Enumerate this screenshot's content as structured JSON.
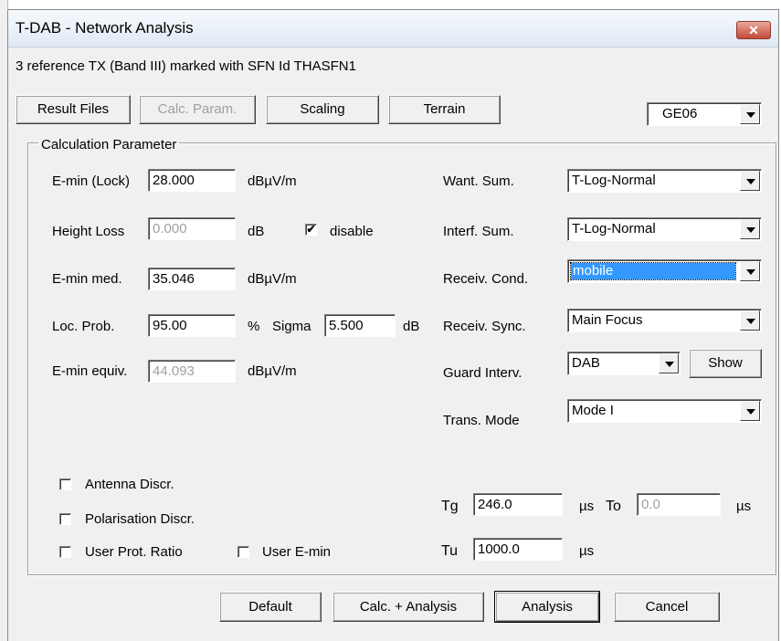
{
  "window": {
    "title": "T-DAB - Network Analysis",
    "close_glyph": "✕",
    "info_line": "3 reference TX (Band III) marked with SFN Id THASFN1"
  },
  "toolbar": {
    "result_files": "Result Files",
    "calc_param": "Calc. Param.",
    "scaling": "Scaling",
    "terrain": "Terrain",
    "plan": "GE06"
  },
  "group": {
    "title": "Calculation Parameter"
  },
  "left": {
    "emin_lock": {
      "label": "E-min (Lock)",
      "value": "28.000",
      "unit": "dBµV/m"
    },
    "height_loss": {
      "label": "Height Loss",
      "value": "0.000",
      "unit": "dB",
      "disable_label": "disable",
      "disable_checked": "✔"
    },
    "emin_med": {
      "label": "E-min med.",
      "value": "35.046",
      "unit": "dBµV/m"
    },
    "loc_prob": {
      "label": "Loc. Prob.",
      "value": "95.00",
      "unit": "%",
      "sigma_label": "Sigma",
      "sigma_value": "5.500",
      "sigma_unit": "dB"
    },
    "emin_equiv": {
      "label": "E-min equiv.",
      "value": "44.093",
      "unit": "dBµV/m"
    }
  },
  "right": {
    "want_sum": {
      "label": "Want. Sum.",
      "value": "T-Log-Normal"
    },
    "interf_sum": {
      "label": "Interf. Sum.",
      "value": "T-Log-Normal"
    },
    "receiv_cond": {
      "label": "Receiv. Cond.",
      "value": "mobile"
    },
    "receiv_sync": {
      "label": "Receiv. Sync.",
      "value": "Main Focus"
    },
    "guard_interv": {
      "label": "Guard Interv.",
      "value": "DAB",
      "show_button": "Show"
    },
    "trans_mode": {
      "label": "Trans. Mode",
      "value": "Mode I"
    }
  },
  "options": {
    "antenna_discr": "Antenna Discr.",
    "polarisation_discr": "Polarisation Discr.",
    "user_prot_ratio": "User Prot. Ratio",
    "user_emin": "User E-min"
  },
  "timing": {
    "tg_label": "Tg",
    "tg_value": "246.0",
    "tg_unit": "µs",
    "to_label": "To",
    "to_value": "0.0",
    "to_unit": "µs",
    "tu_label": "Tu",
    "tu_value": "1000.0",
    "tu_unit": "µs"
  },
  "footer": {
    "default": "Default",
    "calc_analysis": "Calc. + Analysis",
    "analysis": "Analysis",
    "cancel": "Cancel"
  }
}
